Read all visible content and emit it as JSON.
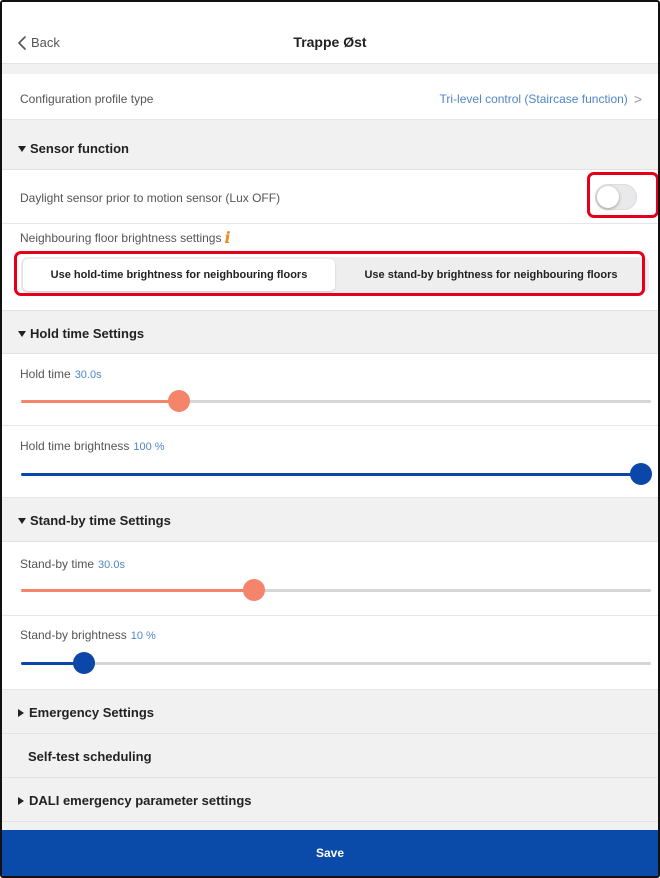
{
  "colors": {
    "accent_blue": "#4f86c6",
    "slider_orange": "#f4846a",
    "slider_blue": "#0a47a8",
    "save_bar": "#0a4aa8",
    "highlight_red": "#e4001b"
  },
  "header": {
    "back_label": "Back",
    "back_icon": "chevron-left-icon",
    "title": "Trappe Øst"
  },
  "config": {
    "label": "Configuration profile type",
    "value": "Tri-level control (Staircase function)",
    "chevron": ">"
  },
  "sensor": {
    "title": "Sensor function",
    "daylight_label": "Daylight sensor prior to motion sensor (Lux OFF)",
    "daylight_on": false,
    "neighbour_label": "Neighbouring floor brightness settings",
    "info_glyph": "i",
    "options": [
      "Use hold-time brightness for neighbouring floors",
      "Use stand-by brightness for neighbouring floors"
    ],
    "selected_option": 0
  },
  "hold": {
    "title": "Hold time Settings",
    "time_label": "Hold time",
    "time_value": "30.0s",
    "time_fraction": 0.25,
    "brightness_label": "Hold time brightness",
    "brightness_value": "100 %",
    "brightness_fraction": 1.0
  },
  "standby": {
    "title": "Stand-by time Settings",
    "time_label": "Stand-by time",
    "time_value": "30.0s",
    "time_fraction": 0.37,
    "brightness_label": "Stand-by brightness",
    "brightness_value": "10 %",
    "brightness_fraction": 0.1
  },
  "emergency": {
    "title": "Emergency Settings",
    "selftest_title": "Self-test scheduling",
    "dali_title": "DALI emergency parameter settings"
  },
  "footer": {
    "save_label": "Save"
  }
}
